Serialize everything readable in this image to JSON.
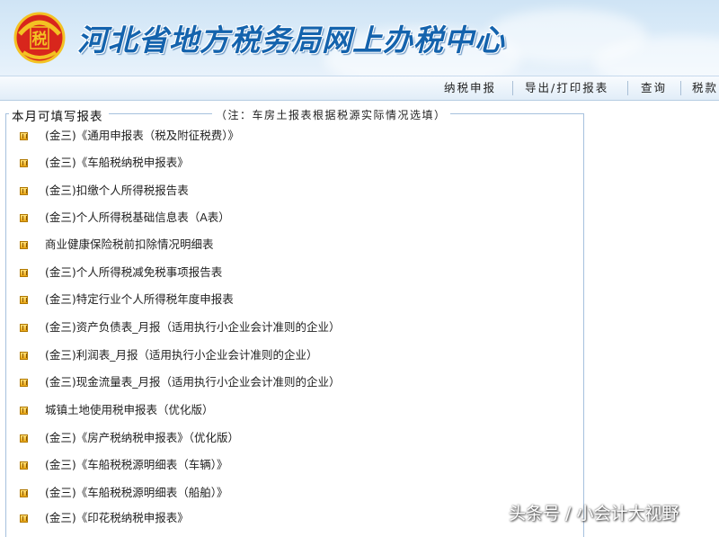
{
  "header": {
    "site_title": "河北省地方税务局网上办税中心",
    "emblem_label": "税",
    "emblem_icon": "tax-emblem-icon",
    "accent_color": "#1463ad"
  },
  "nav": {
    "items": [
      {
        "label": "纳税申报"
      },
      {
        "label": "导出/打印报表"
      },
      {
        "label": "查询"
      },
      {
        "label": "税款"
      }
    ]
  },
  "panel": {
    "title": "本月可填写报表",
    "note": "（注：车房土报表根据税源实际情况选填）",
    "item_icon": "form-item-icon",
    "items": [
      {
        "label": "(金三)《通用申报表（税及附征税费）》"
      },
      {
        "label": "(金三)《车船税纳税申报表》"
      },
      {
        "label": "(金三)扣缴个人所得税报告表"
      },
      {
        "label": "(金三)个人所得税基础信息表（A表）"
      },
      {
        "label": "商业健康保险税前扣除情况明细表"
      },
      {
        "label": "(金三)个人所得税减免税事项报告表"
      },
      {
        "label": "(金三)特定行业个人所得税年度申报表"
      },
      {
        "label": "(金三)资产负债表_月报（适用执行小企业会计准则的企业）"
      },
      {
        "label": "(金三)利润表_月报（适用执行小企业会计准则的企业）"
      },
      {
        "label": "(金三)现金流量表_月报（适用执行小企业会计准则的企业）"
      },
      {
        "label": "城镇土地使用税申报表（优化版）"
      },
      {
        "label": "(金三)《房产税纳税申报表》（优化版）"
      },
      {
        "label": "(金三)《车船税税源明细表（车辆）》"
      },
      {
        "label": "(金三)《车船税税源明细表（船舶）》"
      },
      {
        "label": "(金三)《印花税纳税申报表》"
      }
    ]
  },
  "watermark": {
    "text": "头条号 / 小会计大视野"
  }
}
